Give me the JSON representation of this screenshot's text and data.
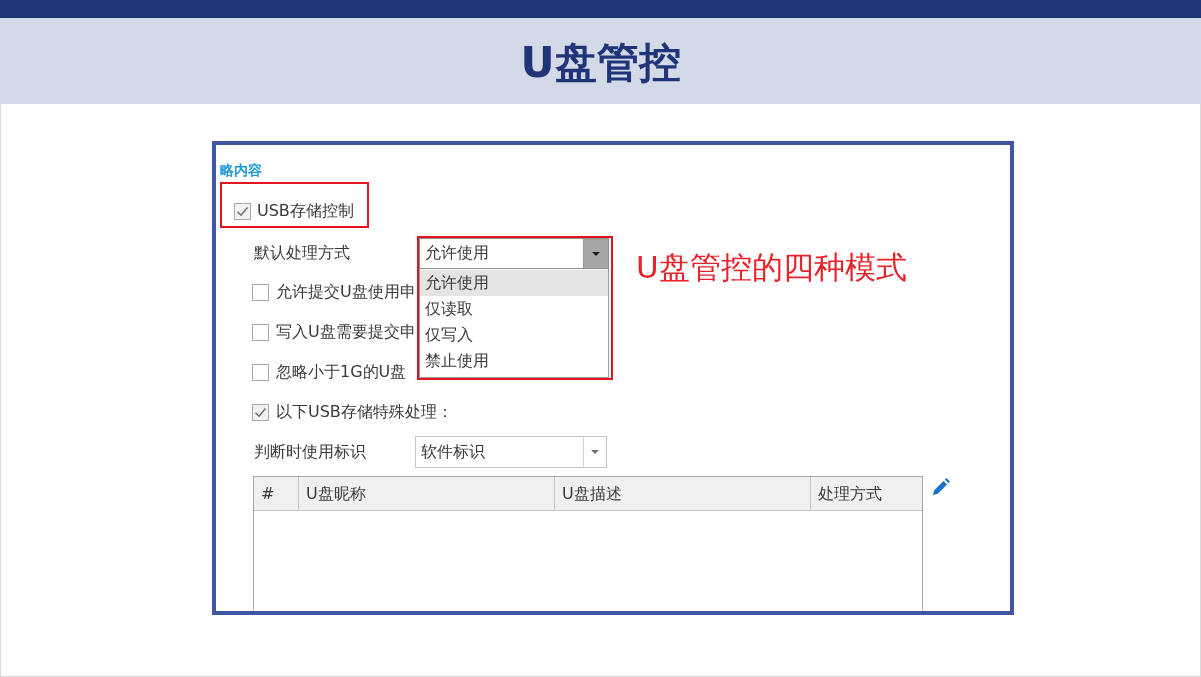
{
  "slide": {
    "title": "U盘管控"
  },
  "screenshot": {
    "section_title": "略内容",
    "usb_storage_control": {
      "label": "USB存储控制",
      "checked": true,
      "highlighted": true
    },
    "default_action": {
      "label": "默认处理方式",
      "value": "允许使用",
      "expanded": true,
      "highlighted": true,
      "options": [
        {
          "label": "允许使用",
          "selected": true
        },
        {
          "label": "仅读取",
          "selected": false
        },
        {
          "label": "仅写入",
          "selected": false
        },
        {
          "label": "禁止使用",
          "selected": false
        }
      ]
    },
    "annotation": "U盘管控的四种模式",
    "checkboxes": [
      {
        "label": "允许提交U盘使用申",
        "checked": false
      },
      {
        "label": "写入U盘需要提交申",
        "checked": false
      },
      {
        "label": "忽略小于1G的U盘",
        "checked": false
      },
      {
        "label": "以下USB存储特殊处理：",
        "checked": true
      }
    ],
    "identifier": {
      "label": "判断时使用标识",
      "value": "软件标识",
      "expanded": false
    },
    "table": {
      "columns": [
        "#",
        "U盘昵称",
        "U盘描述",
        "处理方式"
      ]
    }
  }
}
